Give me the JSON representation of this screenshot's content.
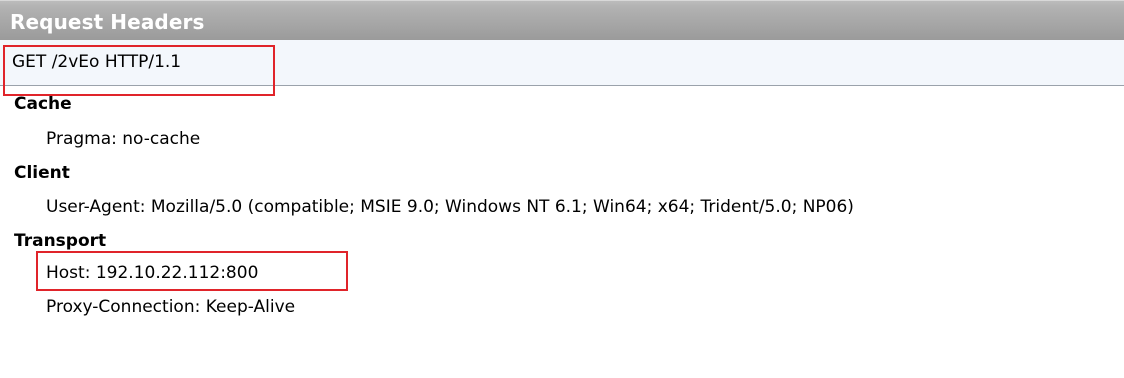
{
  "panel": {
    "title": "Request Headers",
    "request_line": "GET /2vEo HTTP/1.1"
  },
  "groups": {
    "cache": {
      "label": "Cache",
      "headers": [
        "Pragma: no-cache"
      ]
    },
    "client": {
      "label": "Client",
      "headers": [
        "User-Agent: Mozilla/5.0 (compatible; MSIE 9.0; Windows NT 6.1; Win64; x64; Trident/5.0; NP06)"
      ]
    },
    "transport": {
      "label": "Transport",
      "headers": [
        "Host: 192.10.22.112:800",
        "Proxy-Connection: Keep-Alive"
      ]
    }
  },
  "colors": {
    "highlight": "#e0242a",
    "title_bar": "#a8a8a8",
    "request_line_bg": "#f3f7fc"
  }
}
